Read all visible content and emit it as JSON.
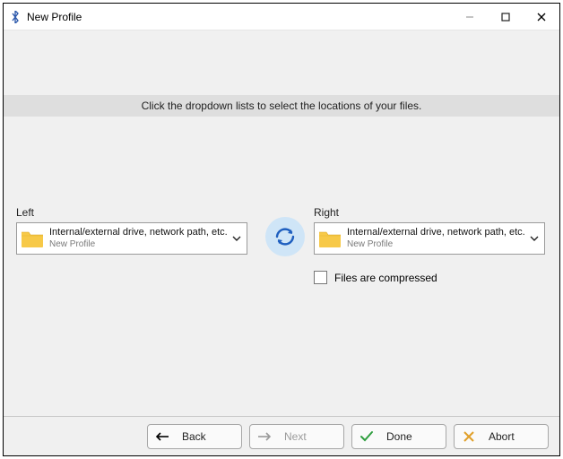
{
  "window": {
    "title": "New Profile"
  },
  "hint": "Click the dropdown lists to select the locations of your files.",
  "left": {
    "label": "Left",
    "combo_main": "Internal/external drive, network path, etc.",
    "combo_sub": "New Profile"
  },
  "right": {
    "label": "Right",
    "combo_main": "Internal/external drive, network path, etc.",
    "combo_sub": "New Profile",
    "compressed_label": "Files are compressed"
  },
  "buttons": {
    "back": "Back",
    "next": "Next",
    "done": "Done",
    "abort": "Abort"
  }
}
